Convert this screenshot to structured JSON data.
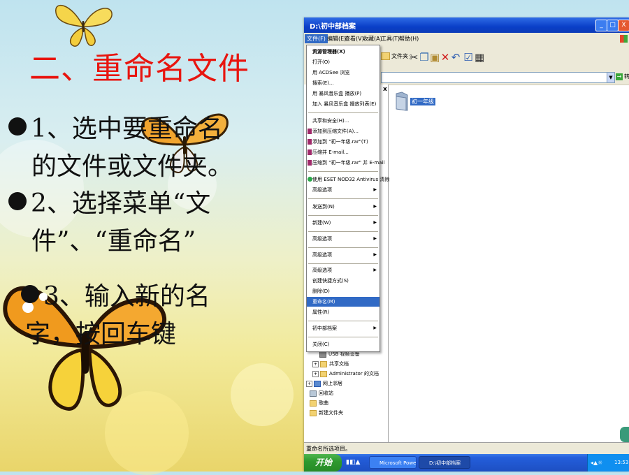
{
  "slide": {
    "title": "二、重命名文件",
    "steps": [
      {
        "line1": "1、选中要重命名",
        "line2": "的文件或文件夹。"
      },
      {
        "line1": "2、选择菜单“文",
        "line2": "件”、“重命名”"
      },
      {
        "line1": "3、输入新的名",
        "line2": "字，按回车键"
      }
    ]
  },
  "colors": {
    "title": "#e8150f",
    "selection": "#316ac5",
    "xp_blue": "#245edb"
  },
  "explorer": {
    "window_title": "D:\\初中部档案",
    "window_buttons": [
      "_",
      "□",
      "X"
    ],
    "menubar": [
      "文件(F)",
      "编辑(E)",
      "查看(V)",
      "收藏(A)",
      "工具(T)",
      "帮助(H)"
    ],
    "toolbar": {
      "folders_label": "文件夹"
    },
    "address": {
      "go_label": "转到"
    },
    "pane_close": "x",
    "selected_folder": "初一年级",
    "context_menu": {
      "items": [
        {
          "label": "资源管理器(X)",
          "bold": true
        },
        {
          "label": "打开(O)"
        },
        {
          "label": "用 ACDSee 浏览"
        },
        {
          "label": "搜索(E)..."
        },
        {
          "label": "用 暴风音乐盒 播放(P)"
        },
        {
          "label": "加入 暴风音乐盒 播放列表(E)"
        },
        {
          "label": "共享和安全(H)..."
        },
        {
          "label": "添加到压缩文件(A)..."
        },
        {
          "label": "添加到 \"初一年级.rar\"(T)"
        },
        {
          "label": "压缩并 E-mail..."
        },
        {
          "label": "压缩到 \"初一年级.rar\" 并 E-mail"
        },
        {
          "label": "使用 ESET NOD32 Antivirus 清除"
        },
        {
          "label": "高级选项",
          "submenu": true
        },
        {
          "label": "发送到(N)",
          "submenu": true
        },
        {
          "label": "新建(W)",
          "submenu": true
        },
        {
          "label": "高级选项",
          "submenu": true
        },
        {
          "label": "高级选项",
          "submenu": true
        },
        {
          "label": "高级选项",
          "submenu": true
        },
        {
          "label": "创建快捷方式(S)"
        },
        {
          "label": "删除(D)"
        },
        {
          "label": "重命名(M)",
          "highlighted": true
        },
        {
          "label": "属性(R)"
        },
        {
          "label": "初中部档案",
          "submenu": true
        },
        {
          "label": "关闭(C)"
        }
      ]
    },
    "tree": [
      {
        "label": "USB 视频设备"
      },
      {
        "label": "共享文档",
        "expander": "+"
      },
      {
        "label": "Administrator 的文档",
        "expander": "+"
      },
      {
        "label": "网上邻居",
        "expander": "+"
      },
      {
        "label": "回收站"
      },
      {
        "label": "歌曲"
      },
      {
        "label": "新建文件夹"
      }
    ],
    "status_text": "重命名所选项目。",
    "taskbar": {
      "start_label": "开始",
      "tasks": [
        "Microsoft PowerP...",
        "D:\\初中部档案"
      ],
      "clock": "13:53"
    }
  }
}
